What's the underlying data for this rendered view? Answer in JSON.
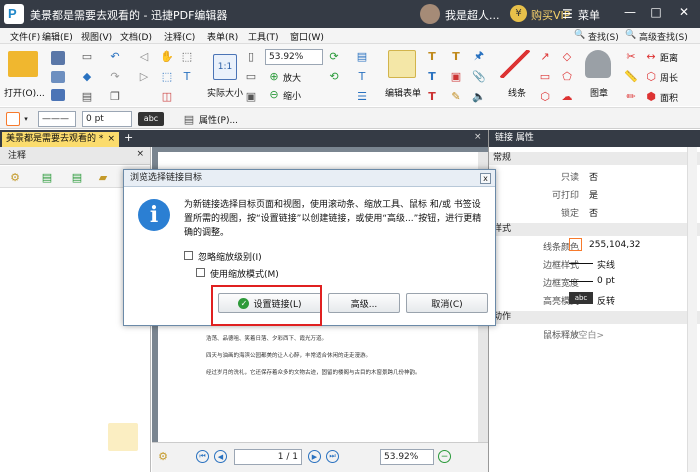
{
  "window": {
    "title": "美景都是需要去观看的 - 迅捷PDF编辑器",
    "user": "我是超人...",
    "vip": "购买VIP",
    "menu": "菜单",
    "min": "—",
    "max": "□",
    "close": "✕"
  },
  "menubar": {
    "items": [
      "文件(F)",
      "编辑(E)",
      "视图(V)",
      "文档(D)",
      "注释(C)",
      "表单(R)",
      "工具(T)",
      "窗口(W)"
    ],
    "find": "查找(S)",
    "adv_find": "高级查找(S)"
  },
  "toolbar": {
    "open": "打开(O)...",
    "zoom_value": "53.92%",
    "actual_size": "实际大小",
    "zoom_in": "放大",
    "zoom_out": "缩小",
    "edit_form": "编辑表单",
    "lines": "线条",
    "stamp": "图章",
    "distance": "距离",
    "perimeter": "周长",
    "area": "面积"
  },
  "toolbar2": {
    "line_width": "0 pt",
    "abc": "abc",
    "properties": "属性(P)..."
  },
  "tabs": {
    "doc": "美景都是需要去观看的 *",
    "close": "×",
    "add": "+"
  },
  "leftpanel": {
    "title": "注释"
  },
  "document": {
    "lines": [
      "浩荡、品德咀、笑着日落、夕彩西下、霞光万道。",
      "四天与油画的海滨公园都美的让人心醉，丰常适合休闲的走走漫游。",
      "经过岁月的洗礼，它还保存着众多的文物古迹，固留的楼阁与古目的木窗景跨几份神韵。"
    ],
    "page": "1 / 1",
    "zoom": "53.92%"
  },
  "rightpanel": {
    "title": "链接 属性",
    "sections": [
      "常规",
      "样式",
      "动作"
    ],
    "rows": [
      {
        "k": "只读",
        "v": "否"
      },
      {
        "k": "可打印",
        "v": "是"
      },
      {
        "k": "锁定",
        "v": "否"
      },
      {
        "k": "线条颜色",
        "v": "255,104,32"
      },
      {
        "k": "边框样式",
        "v": "实线"
      },
      {
        "k": "边框宽度",
        "v": "0 pt"
      },
      {
        "k": "高亮模式",
        "v": "反转"
      },
      {
        "k": "鼠标释放",
        "v": "<空白>"
      }
    ],
    "abc": "abc",
    "line_color": "#f77a2c"
  },
  "dialog": {
    "title": "浏览选择链接目标",
    "close": "x",
    "message": "为新链接选择目标页面和视图，使用滚动条、缩放工具、鼠标 和/或 书签设置所需的视图，按“设置链接”以创建链接，或使用“高级...”按钮，进行更精确的调整。",
    "ignore_zoom": "忽略缩放级别(I)",
    "use_zoom_mode": "使用缩放模式(M)",
    "set_link": "设置链接(L)",
    "advanced": "高级...",
    "cancel": "取消(C)"
  },
  "colors": {
    "title_bg": "#353b45",
    "tab_active": "#fbdc6d",
    "highlight": "#e02020",
    "info": "#2b7fd3"
  }
}
